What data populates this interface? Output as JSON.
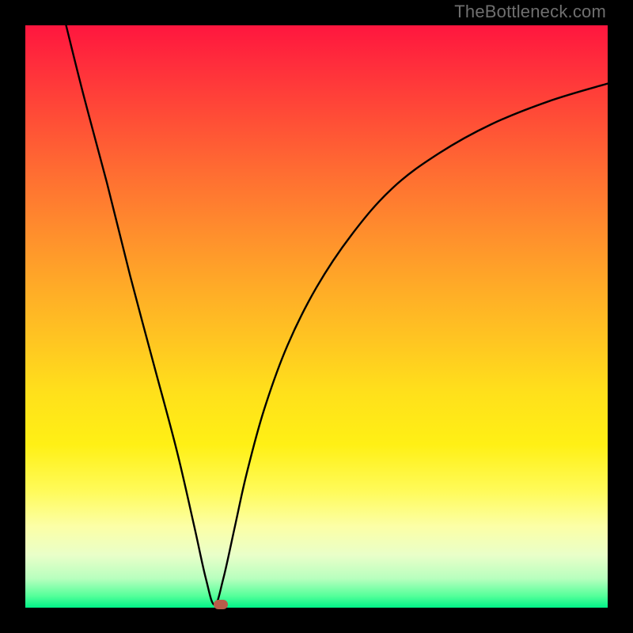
{
  "watermark": {
    "text": "TheBottleneck.com"
  },
  "chart_data": {
    "type": "line",
    "title": "",
    "xlabel": "",
    "ylabel": "",
    "xlim": [
      0,
      100
    ],
    "ylim": [
      0,
      100
    ],
    "grid": false,
    "legend": false,
    "series": [
      {
        "name": "curve",
        "x": [
          7,
          10,
          14,
          18,
          22,
          26,
          29,
          31,
          32.5,
          34,
          36,
          38,
          41,
          45,
          50,
          56,
          63,
          71,
          80,
          90,
          100
        ],
        "y": [
          100,
          88,
          73,
          57,
          42,
          27,
          14,
          5,
          0.5,
          5,
          14,
          23,
          34,
          45,
          55,
          64,
          72,
          78,
          83,
          87,
          90
        ]
      }
    ],
    "marker": {
      "x": 33.5,
      "y": 0.5
    },
    "background_gradient": {
      "stops": [
        {
          "pos": 0,
          "color": "#ff163e"
        },
        {
          "pos": 50,
          "color": "#ffbd24"
        },
        {
          "pos": 80,
          "color": "#fffb5a"
        },
        {
          "pos": 100,
          "color": "#00f287"
        }
      ]
    }
  }
}
